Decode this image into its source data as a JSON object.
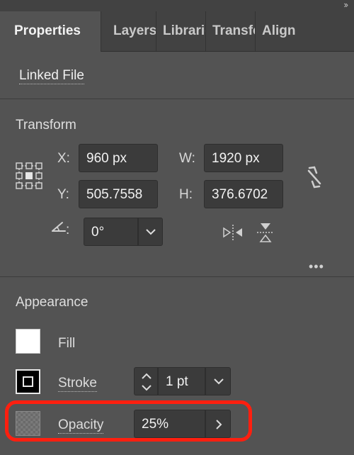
{
  "header": {
    "collapse_icon": "double-chevron-right-icon",
    "collapse_glyph": "››"
  },
  "tabs": [
    {
      "label": "Properties",
      "active": true
    },
    {
      "label": "Layers",
      "active": false
    },
    {
      "label": "Libraries",
      "active": false
    },
    {
      "label": "Transform",
      "active": false
    },
    {
      "label": "Align",
      "active": false
    }
  ],
  "linked_file": {
    "label": "Linked File"
  },
  "transform": {
    "title": "Transform",
    "x_label": "X:",
    "x_value": "960 px",
    "y_label": "Y:",
    "y_value": "505.7558",
    "w_label": "W:",
    "w_value": "1920 px",
    "h_label": "H:",
    "h_value": "376.6702",
    "angle_label": ":",
    "angle_value": "0°",
    "more_glyph": "•••"
  },
  "appearance": {
    "title": "Appearance",
    "fill_label": "Fill",
    "fill_color": "#ffffff",
    "stroke_label": "Stroke",
    "stroke_weight": "1 pt",
    "opacity_label": "Opacity",
    "opacity_value": "25%"
  },
  "colors": {
    "highlight": "#ff1f0f",
    "panel": "#535353",
    "field": "#3b3b3b"
  }
}
